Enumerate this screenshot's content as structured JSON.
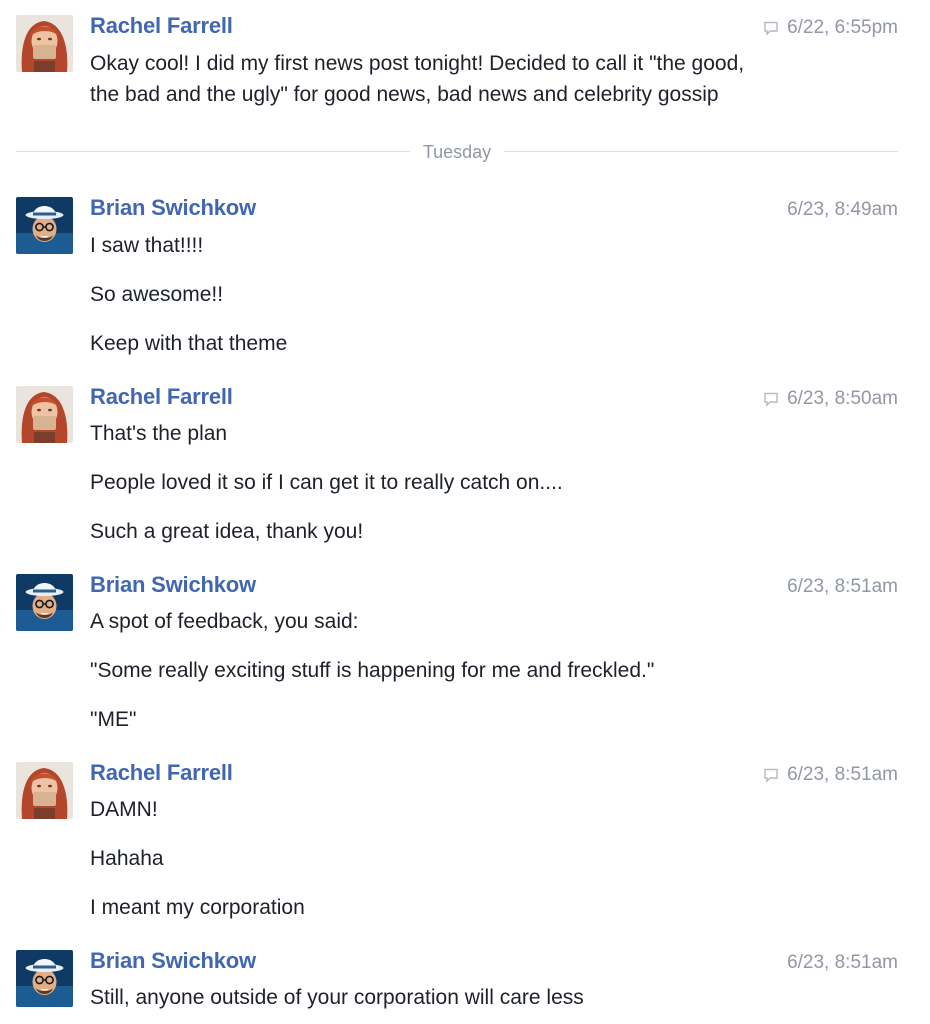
{
  "participants": {
    "rachel": {
      "name": "Rachel Farrell",
      "avatar_icon": "avatar-rachel-redhead"
    },
    "brian": {
      "name": "Brian Swichkow",
      "avatar_icon": "avatar-brian-hat-glasses"
    }
  },
  "colors": {
    "author": "#4267b2",
    "timestamp": "#9197a3",
    "text": "#1d2129",
    "divider": "#dcdee3"
  },
  "divider": {
    "label": "Tuesday"
  },
  "messages": [
    {
      "author": "Rachel Farrell",
      "time": "6/22, 6:55pm",
      "has_chat_icon": true,
      "lines": [
        "Okay cool! I did my first news post tonight! Decided to call it \"the good,",
        "the bad and the ugly\" for good news, bad news and celebrity gossip"
      ]
    },
    {
      "author": "Brian Swichkow",
      "time": "6/23, 8:49am",
      "has_chat_icon": false,
      "lines": [
        "I saw that!!!!",
        "So awesome!!",
        "Keep with that theme"
      ]
    },
    {
      "author": "Rachel Farrell",
      "time": "6/23, 8:50am",
      "has_chat_icon": true,
      "lines": [
        "That's the plan",
        "People loved it so if I can get it to really catch on....",
        "Such a great idea, thank you!"
      ]
    },
    {
      "author": "Brian Swichkow",
      "time": "6/23, 8:51am",
      "has_chat_icon": false,
      "lines": [
        "A spot of feedback, you said:",
        "\"Some really exciting stuff is happening for me and freckled.\"",
        "\"ME\""
      ]
    },
    {
      "author": "Rachel Farrell",
      "time": "6/23, 8:51am",
      "has_chat_icon": true,
      "lines": [
        "DAMN!",
        "Hahaha",
        "I meant my corporation"
      ]
    },
    {
      "author": "Brian Swichkow",
      "time": "6/23, 8:51am",
      "has_chat_icon": false,
      "lines": [
        "Still, anyone outside of your corporation will care less"
      ]
    }
  ]
}
